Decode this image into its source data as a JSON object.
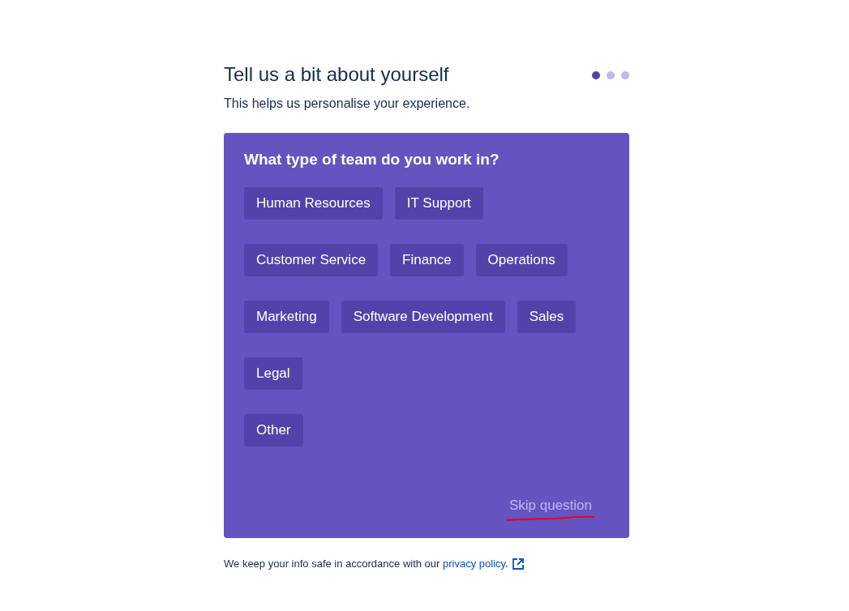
{
  "header": {
    "title": "Tell us a bit about yourself",
    "subtitle": "This helps us personalise your experience."
  },
  "steps": [
    {
      "selected": true
    },
    {
      "selected": false
    },
    {
      "selected": false
    }
  ],
  "question": {
    "title": "What type of team do you work in?",
    "options": [
      {
        "label": "Human Resources",
        "selected": false
      },
      {
        "label": "IT Support",
        "selected": false
      },
      {
        "label": "Customer Service",
        "selected": false
      },
      {
        "label": "Finance",
        "selected": false
      },
      {
        "label": "Operations",
        "selected": false
      },
      {
        "label": "Marketing",
        "selected": false
      },
      {
        "label": "Software Development",
        "selected": false
      },
      {
        "label": "Sales",
        "selected": false
      },
      {
        "label": "Legal",
        "selected": false
      },
      {
        "label": "Other",
        "selected": false
      }
    ],
    "skip": "Skip question"
  },
  "footer": {
    "text": "We keep your info safe in accordance with our ",
    "link": "privacy policy",
    "after": "."
  }
}
